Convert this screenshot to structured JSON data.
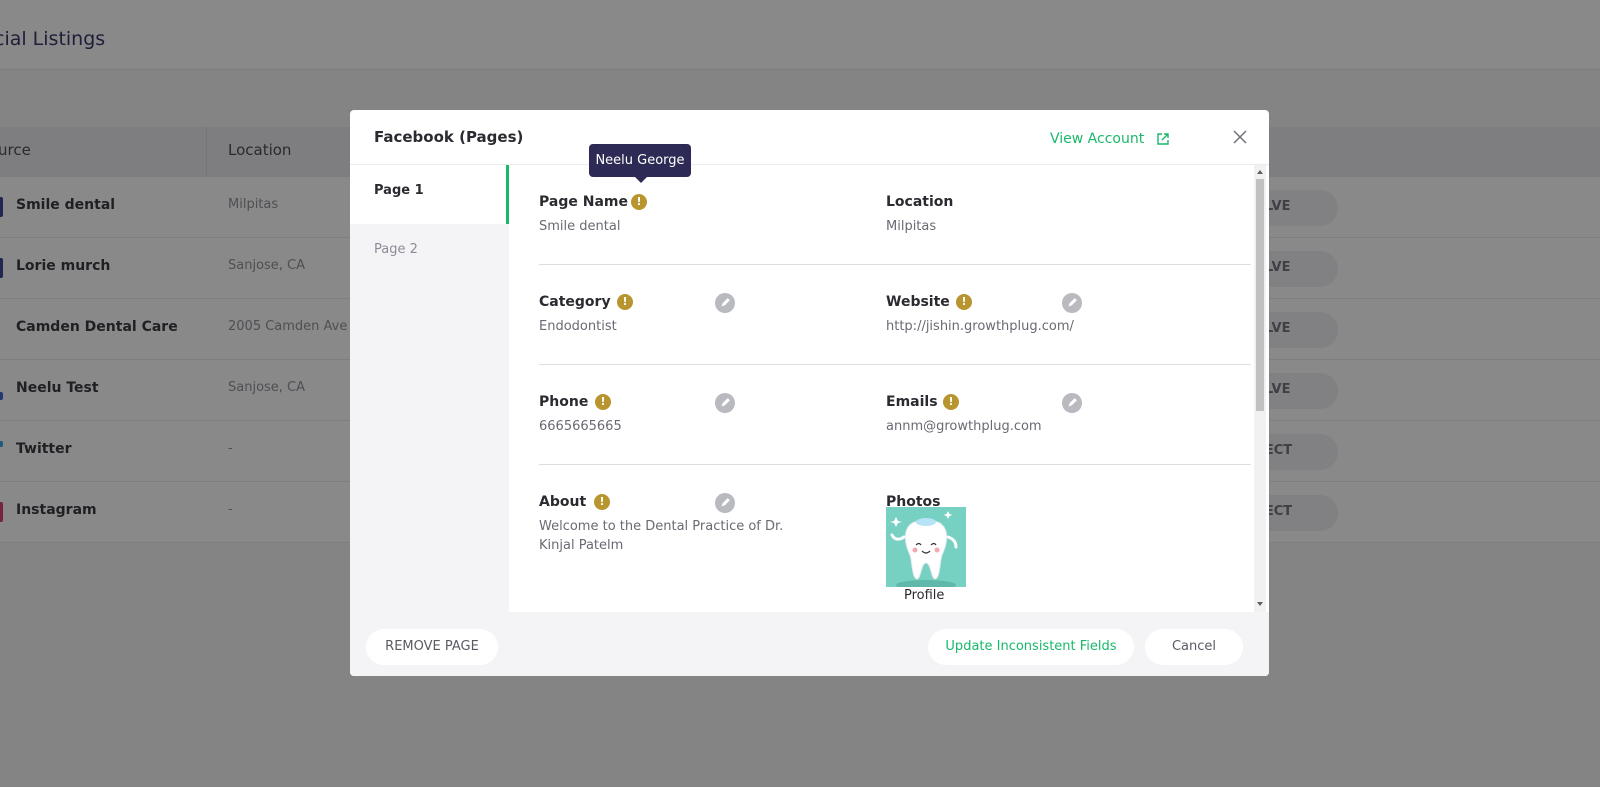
{
  "background": {
    "page_title": "cial Listings",
    "columns": {
      "source": "urce",
      "location": "Location"
    },
    "rows": [
      {
        "source": "Smile dental",
        "location": "Milpitas",
        "action": "OLVE"
      },
      {
        "source": "Lorie murch",
        "location": "Sanjose, CA",
        "action": "OLVE"
      },
      {
        "source": "Camden Dental Care",
        "location": "2005 Camden Ave",
        "action": "OLVE"
      },
      {
        "source": "Neelu Test",
        "location": "Sanjose, CA",
        "action": "OLVE"
      },
      {
        "source": "Twitter",
        "location": "-",
        "action": "NECT"
      },
      {
        "source": "Instagram",
        "location": "-",
        "action": "NECT"
      }
    ]
  },
  "modal": {
    "title": "Facebook (Pages)",
    "view_account_label": "View Account",
    "nav": [
      {
        "label": "Page 1",
        "active": true
      },
      {
        "label": "Page 2",
        "active": false
      }
    ],
    "fields": {
      "page_name": {
        "label": "Page Name",
        "value": "Smile dental"
      },
      "location": {
        "label": "Location",
        "value": "Milpitas"
      },
      "category": {
        "label": "Category",
        "value": "Endodontist"
      },
      "website": {
        "label": "Website",
        "value": "http://jishin.growthplug.com/"
      },
      "phone": {
        "label": "Phone",
        "value": "6665665665"
      },
      "emails": {
        "label": "Emails",
        "value": "annm@growthplug.com"
      },
      "about": {
        "label": "About",
        "value_line1": "Welcome to the Dental Practice of Dr.",
        "value_line2": "Kinjal Patelm"
      },
      "photos": {
        "label": "Photos",
        "caption": "Profile"
      }
    },
    "footer": {
      "remove_label": "REMOVE PAGE",
      "update_label": "Update Inconsistent Fields",
      "cancel_label": "Cancel"
    }
  },
  "tooltip": {
    "text": "Neelu George"
  },
  "icons": {
    "warning": "warning-icon",
    "edit": "pencil-icon",
    "close": "close-icon",
    "external_link": "external-link-icon"
  },
  "colors": {
    "accent_green": "#19b86b",
    "warning_gold": "#b8952e",
    "tooltip_bg": "#2d2b55",
    "photo_bg": "#76d1c2"
  }
}
